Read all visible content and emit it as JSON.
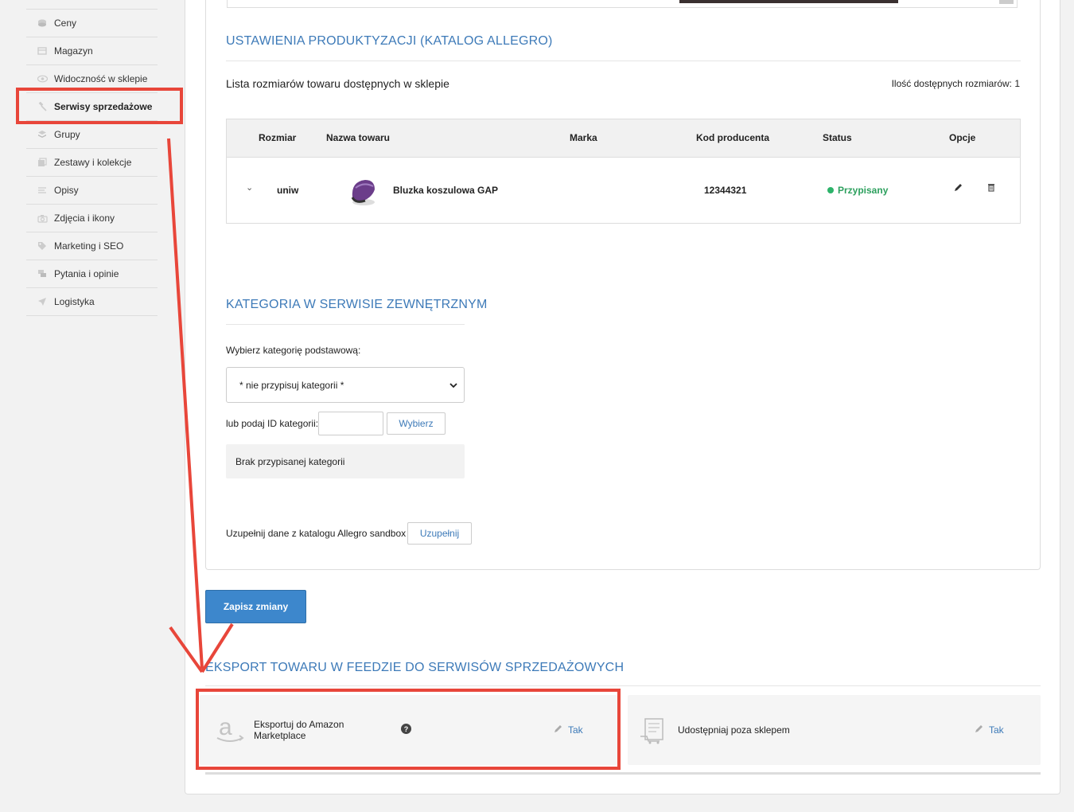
{
  "sidebar": {
    "items": [
      {
        "label": "Ceny",
        "icon": "coins-icon"
      },
      {
        "label": "Magazyn",
        "icon": "warehouse-icon"
      },
      {
        "label": "Widoczność w sklepie",
        "icon": "eye-icon"
      },
      {
        "label": "Serwisy sprzedażowe",
        "icon": "gavel-icon",
        "active": true
      },
      {
        "label": "Grupy",
        "icon": "layers-icon"
      },
      {
        "label": "Zestawy i kolekcje",
        "icon": "collection-icon"
      },
      {
        "label": "Opisy",
        "icon": "text-lines-icon"
      },
      {
        "label": "Zdjęcia i ikony",
        "icon": "camera-icon"
      },
      {
        "label": "Marketing i SEO",
        "icon": "tag-icon"
      },
      {
        "label": "Pytania i opinie",
        "icon": "comments-icon"
      },
      {
        "label": "Logistyka",
        "icon": "paper-plane-icon"
      }
    ]
  },
  "productization": {
    "title": "USTAWIENIA PRODUKTYZACJI (KATALOG ALLEGRO)",
    "list_title": "Lista rozmiarów towaru dostępnych w sklepie",
    "sizes_count": "Ilość dostępnych rozmiarów: 1",
    "table": {
      "headers": [
        "Rozmiar",
        "Nazwa towaru",
        "Marka",
        "Kod producenta",
        "Status",
        "Opcje"
      ],
      "rows": [
        {
          "size": "uniw",
          "name": "Bluzka koszulowa GAP",
          "brand": "",
          "code": "12344321",
          "status": "Przypisany"
        }
      ]
    }
  },
  "category": {
    "title": "KATEGORIA W SERWISIE ZEWNĘTRZNYM",
    "select_label": "Wybierz kategorię podstawową:",
    "select_value": "* nie przypisuj kategorii *",
    "id_label": "lub podaj ID kategorii:",
    "id_value": "",
    "choose_button": "Wybierz",
    "no_category": "Brak przypisanej kategorii",
    "fill_label": "Uzupełnij dane z katalogu Allegro sandbox",
    "fill_button": "Uzupełnij"
  },
  "save_button": "Zapisz zmiany",
  "export": {
    "title": "EKSPORT TOWARU W FEEDZIE DO SERWISÓW SPRZEDAŻOWYCH",
    "items": [
      {
        "label_line1": "Eksportuj do Amazon",
        "label_line2": "Marketplace",
        "value": "Tak",
        "icon": "amazon-icon"
      },
      {
        "label_line1": "Udostępniaj poza sklepem",
        "label_line2": "",
        "value": "Tak",
        "icon": "share-feed-icon"
      }
    ]
  },
  "colors": {
    "accent": "#3d7ab8",
    "status_ok": "#2db36a",
    "annotation": "#e8463a",
    "save_button": "#3d87cc"
  }
}
